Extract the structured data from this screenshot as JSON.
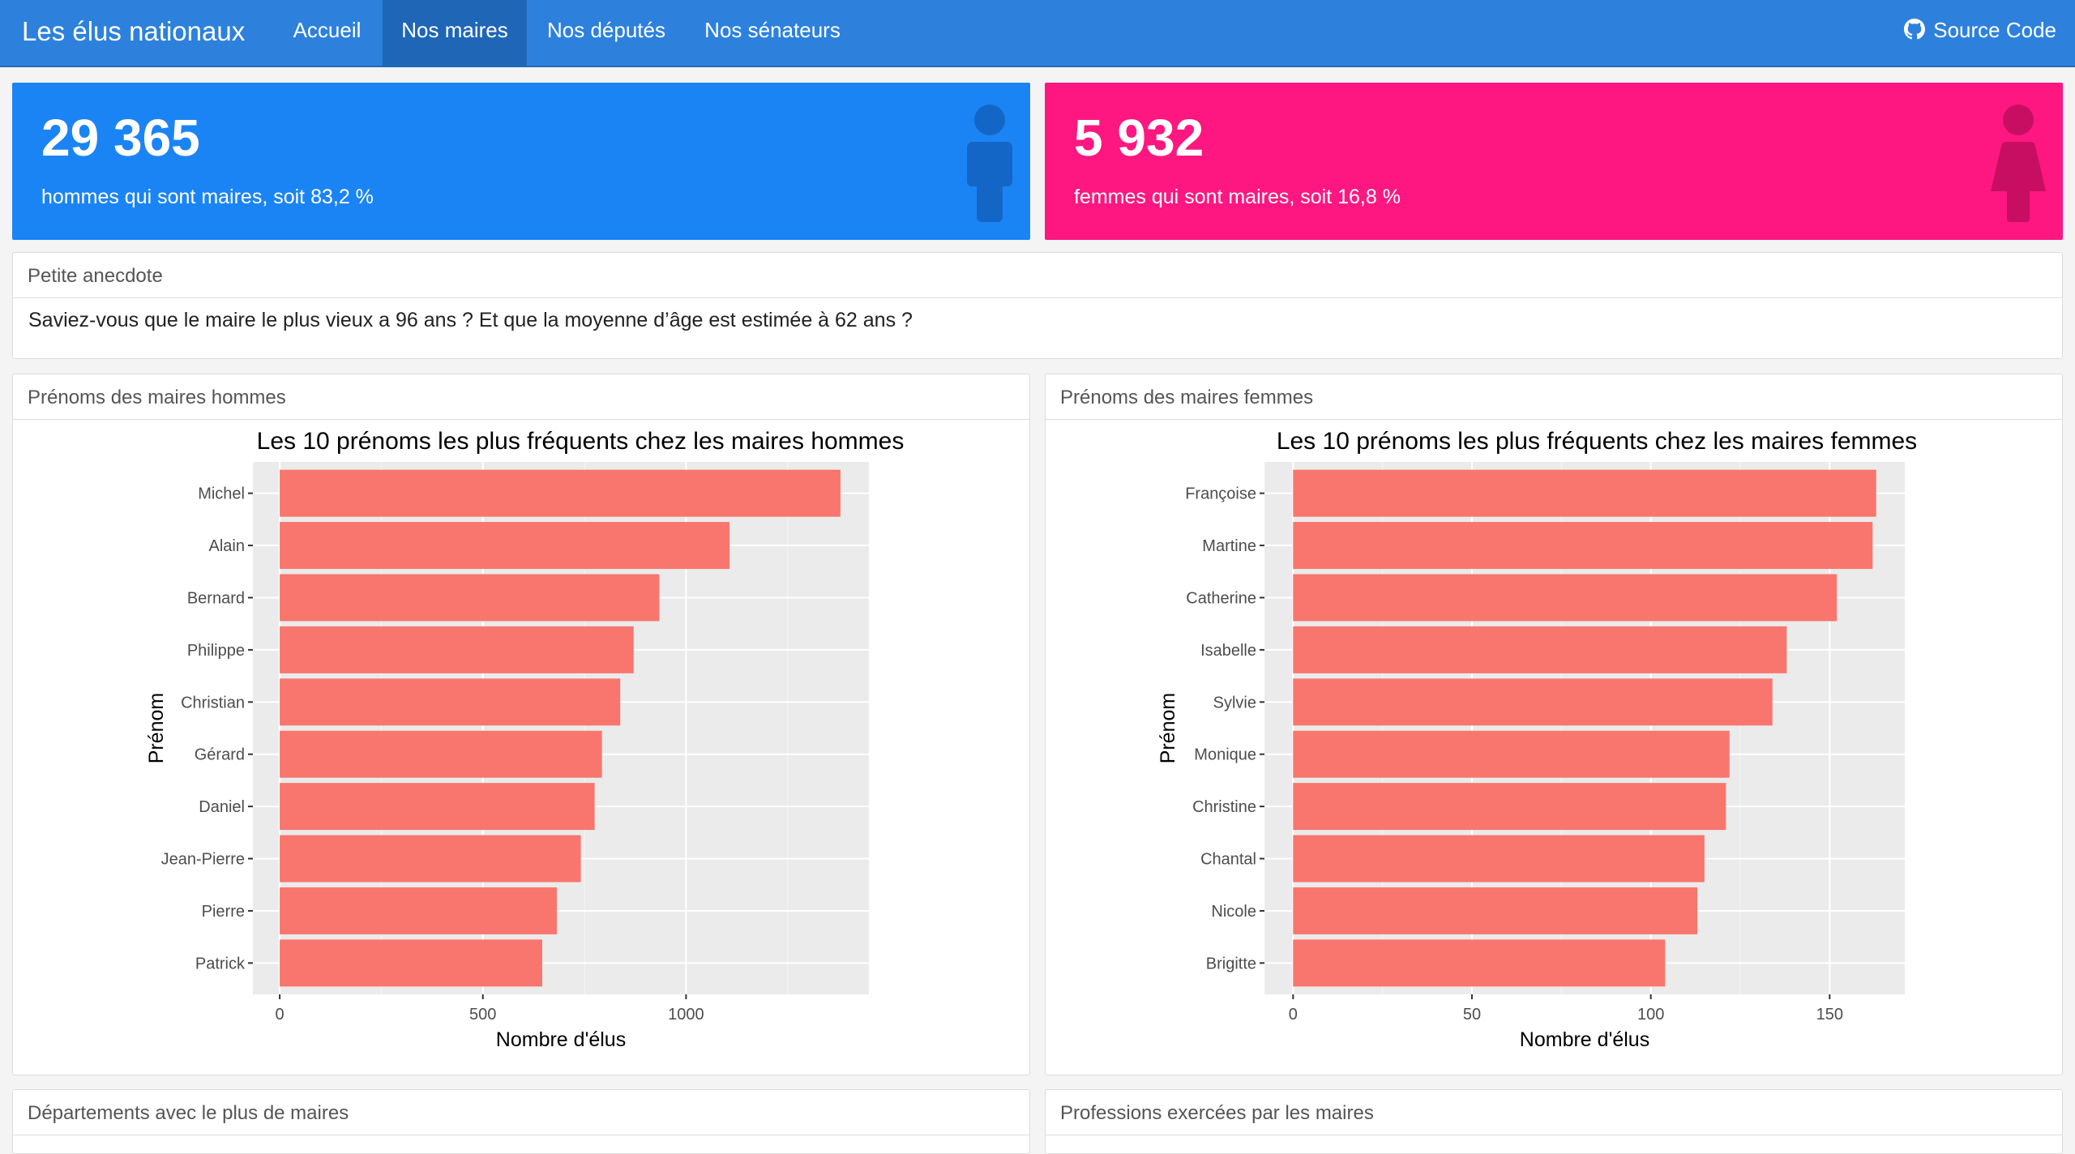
{
  "nav": {
    "brand": "Les élus nationaux",
    "items": [
      "Accueil",
      "Nos maires",
      "Nos députés",
      "Nos sénateurs"
    ],
    "active_index": 1,
    "source_code": "Source Code"
  },
  "value_boxes": {
    "men": {
      "value": "29 365",
      "caption": "hommes qui sont maires, soit 83,2 %",
      "color": "#1b84f5",
      "icon": "male-person-icon"
    },
    "women": {
      "value": "5 932",
      "caption": "femmes qui sont maires, soit 16,8 %",
      "color": "#fe1780",
      "icon": "female-person-icon"
    }
  },
  "anecdote": {
    "header": "Petite anecdote",
    "text": "Saviez-vous que le maire le plus vieux a 96 ans ? Et que la moyenne d’âge est estimée à 62 ans ?"
  },
  "cards": {
    "men_names_header": "Prénoms des maires hommes",
    "women_names_header": "Prénoms des maires femmes",
    "departments_header": "Départements avec le plus de maires",
    "professions_header": "Professions exercées par les maires"
  },
  "chart_data": [
    {
      "type": "bar",
      "orientation": "horizontal",
      "title": "Les 10 prénoms les plus fréquents chez les maires hommes",
      "xlabel": "Nombre d'élus",
      "ylabel": "Prénom",
      "categories": [
        "Michel",
        "Alain",
        "Bernard",
        "Philippe",
        "Christian",
        "Gérard",
        "Daniel",
        "Jean-Pierre",
        "Pierre",
        "Patrick"
      ],
      "values": [
        1380,
        1107,
        934,
        871,
        838,
        793,
        775,
        741,
        682,
        646
      ],
      "xlim": [
        -66,
        1450
      ],
      "xticks": [
        0,
        500,
        1000
      ],
      "bar_color": "#f8766d",
      "panel_color": "#ebebeb",
      "grid": true
    },
    {
      "type": "bar",
      "orientation": "horizontal",
      "title": "Les 10 prénoms les plus fréquents chez les maires femmes",
      "xlabel": "Nombre d'élus",
      "ylabel": "Prénom",
      "categories": [
        "Françoise",
        "Martine",
        "Catherine",
        "Isabelle",
        "Sylvie",
        "Monique",
        "Christine",
        "Chantal",
        "Nicole",
        "Brigitte"
      ],
      "values": [
        163,
        162,
        152,
        138,
        134,
        122,
        121,
        115,
        113,
        104
      ],
      "xlim": [
        -8,
        171
      ],
      "xticks": [
        0,
        50,
        100,
        150
      ],
      "bar_color": "#f8766d",
      "panel_color": "#ebebeb",
      "grid": true
    }
  ]
}
